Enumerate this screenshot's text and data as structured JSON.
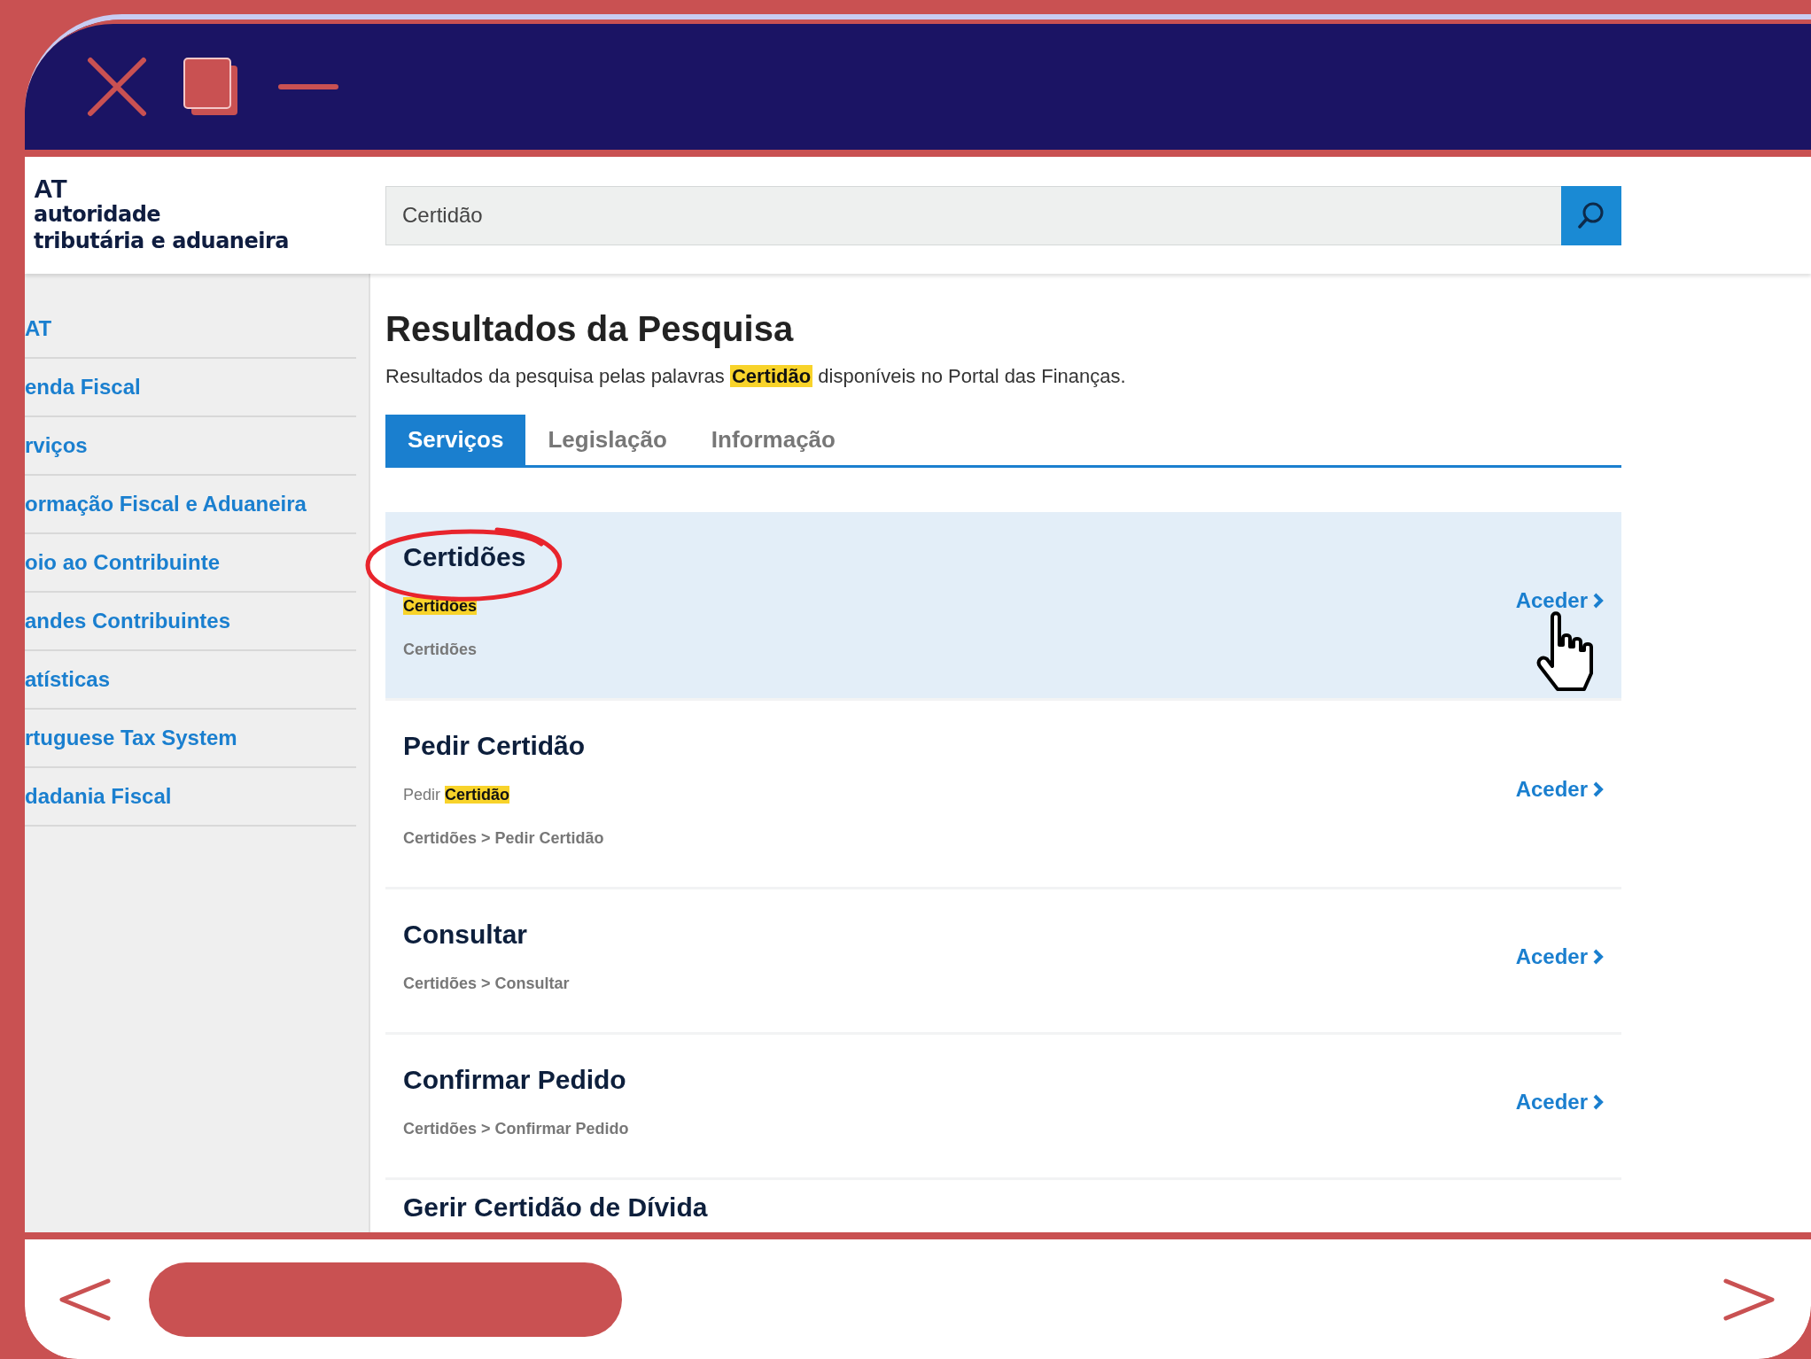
{
  "window": {
    "controls": [
      {
        "kind": "close"
      },
      {
        "kind": "restore"
      },
      {
        "kind": "minimize"
      }
    ]
  },
  "logo": {
    "mark": "AT",
    "line_1": "autoridade",
    "line_2": "tributária e aduaneira"
  },
  "search": {
    "value": "Certidão"
  },
  "sidebar": {
    "items": [
      {
        "label": "AT"
      },
      {
        "label": "enda Fiscal"
      },
      {
        "label": "rviços"
      },
      {
        "label": "ormação Fiscal e Aduaneira"
      },
      {
        "label": "oio ao Contribuinte"
      },
      {
        "label": "andes Contribuintes"
      },
      {
        "label": "atísticas"
      },
      {
        "label": "rtuguese Tax System"
      },
      {
        "label": "dadania Fiscal"
      }
    ]
  },
  "page": {
    "title": "Resultados da Pesquisa",
    "subtitle": "Resultados da pesquisa pelas palavras **Certidão** disponíveis no Portal das Finanças."
  },
  "tabs": [
    {
      "label": "Serviços",
      "selected": true
    },
    {
      "label": "Legislação",
      "selected": false
    },
    {
      "label": "Informação",
      "selected": false
    }
  ],
  "results": [
    {
      "title": "Certidões",
      "snippet": "**Certidões**",
      "path": "Certidões",
      "link": "Aceder",
      "hovered": true,
      "circled": true
    },
    {
      "title": "Pedir Certidão",
      "snippet": "Pedir **Certidão**",
      "path": "Certidões > Pedir Certidão",
      "link": "Aceder",
      "hovered": false,
      "circled": false
    },
    {
      "title": "Consultar",
      "path": "Certidões > Consultar",
      "link": "Aceder",
      "hovered": false,
      "circled": false
    },
    {
      "title": "Confirmar Pedido",
      "path": "Certidões > Confirmar Pedido",
      "link": "Aceder",
      "hovered": false,
      "circled": false
    },
    {
      "title": "Gerir Certidão de Dívida",
      "hovered": false,
      "circled": false
    }
  ]
}
